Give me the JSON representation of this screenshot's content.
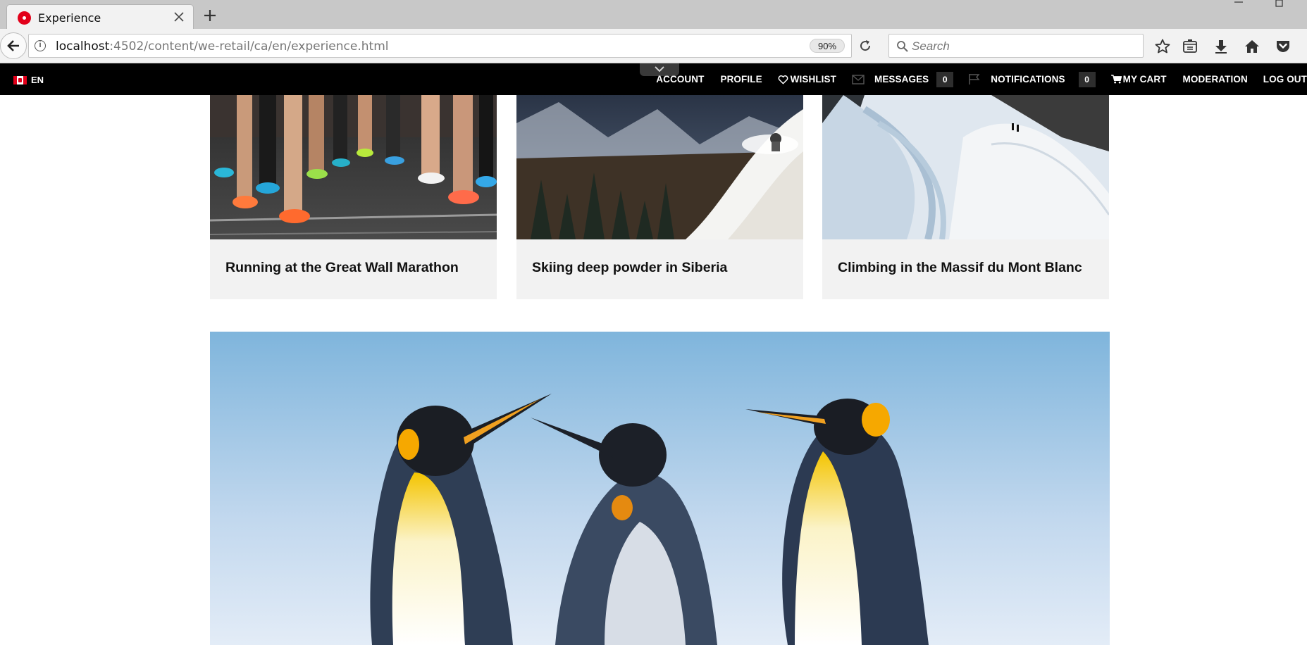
{
  "browser": {
    "tab_title": "Experience",
    "url_host": "localhost",
    "url_path": ":4502/content/we-retail/ca/en/experience.html",
    "zoom": "90%",
    "search_placeholder": "Search"
  },
  "site_header": {
    "language": "EN",
    "nav": {
      "account": "ACCOUNT",
      "profile": "PROFILE",
      "wishlist": "WISHLIST",
      "messages": "MESSAGES",
      "messages_count": "0",
      "notifications": "NOTIFICATIONS",
      "notifications_count": "0",
      "cart": "MY CART",
      "moderation": "MODERATION",
      "logout": "LOG OUT"
    }
  },
  "cards": [
    {
      "title": "Running at the Great Wall Marathon",
      "image": "marathon-runners-legs"
    },
    {
      "title": "Skiing deep powder in Siberia",
      "image": "skier-on-powder-slope"
    },
    {
      "title": "Climbing in the Massif du Mont Blanc",
      "image": "climbers-on-snow-ridge"
    }
  ],
  "hero_image": "king-penguins",
  "colors": {
    "site_bar": "#000000",
    "caption_bg": "#f2f2f2",
    "brand_red": "#e2001a"
  }
}
